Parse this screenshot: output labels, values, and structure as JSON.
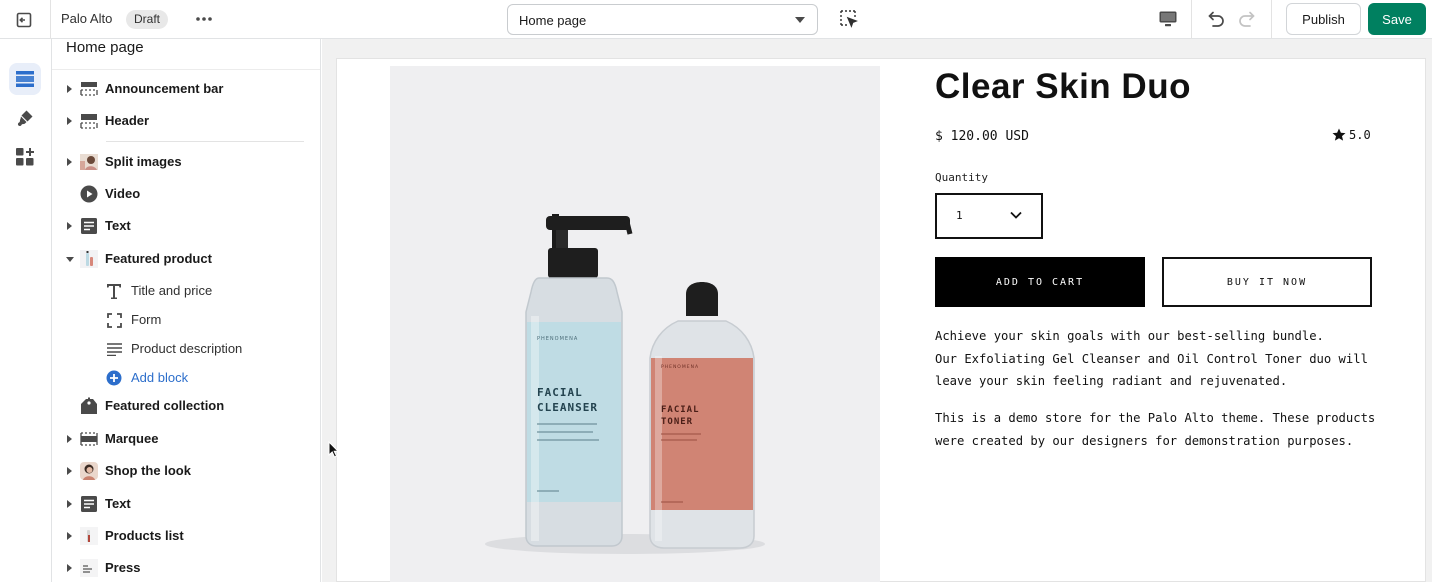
{
  "topbar": {
    "theme_name": "Palo Alto",
    "status_badge": "Draft",
    "page_selector": "Home page",
    "publish_label": "Publish",
    "save_label": "Save"
  },
  "colors": {
    "save": "#008060",
    "link": "#2c6ecb",
    "rail_active": "#e8eef9"
  },
  "rail": {
    "items": [
      {
        "icon": "sections-icon",
        "active": true
      },
      {
        "icon": "theme-settings-icon",
        "active": false
      },
      {
        "icon": "app-embeds-icon",
        "active": false
      }
    ]
  },
  "sidebar": {
    "title": "Home page",
    "sections": [
      {
        "label": "Announcement bar",
        "icon": "announcement-bar-icon"
      },
      {
        "label": "Header",
        "icon": "header-icon"
      },
      {
        "label": "Split images",
        "icon": "split-images-thumb-icon"
      },
      {
        "label": "Video",
        "icon": "video-icon"
      },
      {
        "label": "Text",
        "icon": "text-icon"
      },
      {
        "label": "Featured product",
        "icon": "featured-product-thumb-icon",
        "expanded": true
      },
      {
        "label": "Featured collection",
        "icon": "collection-tag-icon"
      },
      {
        "label": "Marquee",
        "icon": "marquee-icon"
      },
      {
        "label": "Shop the look",
        "icon": "shop-the-look-thumb-icon"
      },
      {
        "label": "Text",
        "icon": "text-icon"
      },
      {
        "label": "Products list",
        "icon": "products-list-thumb-icon"
      },
      {
        "label": "Press",
        "icon": "press-thumb-icon"
      }
    ],
    "blocks": [
      {
        "label": "Title and price",
        "icon": "title-icon"
      },
      {
        "label": "Form",
        "icon": "form-icon"
      },
      {
        "label": "Product description",
        "icon": "description-icon"
      },
      {
        "label": "Add block",
        "icon": "add-circle-icon"
      }
    ]
  },
  "product": {
    "title": "Clear Skin Duo",
    "price": "$ 120.00 USD",
    "rating": "5.0",
    "quantity_label": "Quantity",
    "quantity_value": "1",
    "add_to_cart": "ADD TO CART",
    "buy_it_now": "BUY IT NOW",
    "description_1": "Achieve your skin goals with our best-selling bundle.\nOur Exfoliating Gel Cleanser and Oil Control Toner duo will\nleave your skin feeling radiant and rejuvenated.",
    "description_2": "This is a demo store for the Palo Alto theme. These products\nwere created by our designers for demonstration purposes.",
    "bottles": {
      "brand": "PHENOMENA",
      "cleanser_name": "FACIAL\nCLEANSER",
      "toner_name": "FACIAL\nTONER"
    }
  }
}
